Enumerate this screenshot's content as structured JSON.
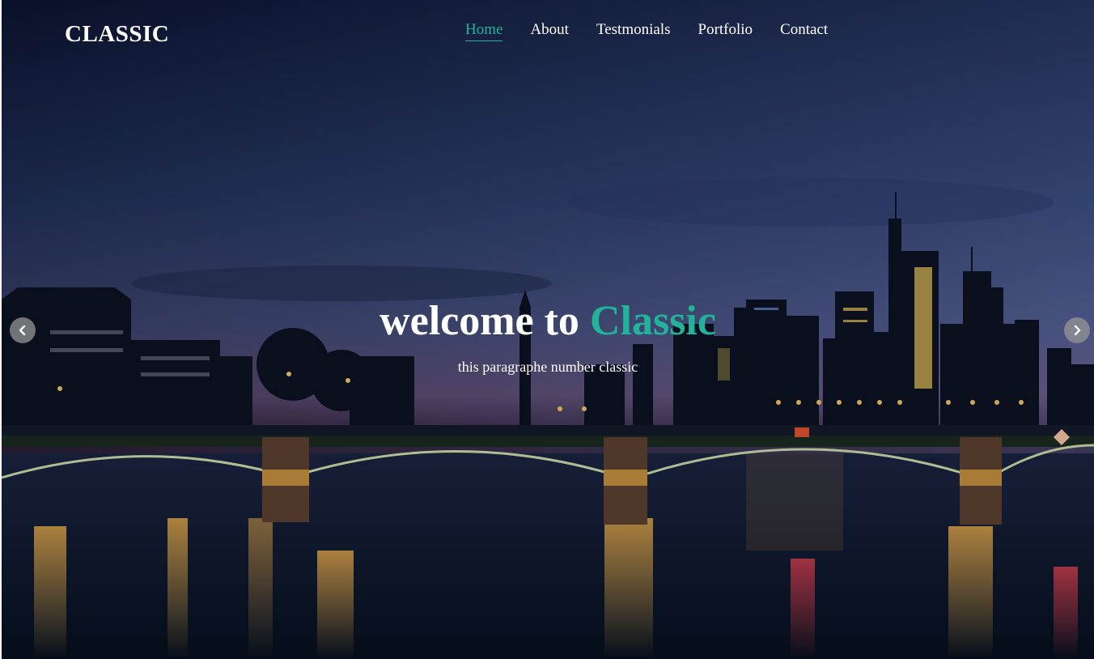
{
  "brand": {
    "name": "CLASSIC"
  },
  "nav": {
    "items": [
      {
        "label": "Home",
        "active": true
      },
      {
        "label": "About",
        "active": false
      },
      {
        "label": "Testmonials",
        "active": false
      },
      {
        "label": "Portfolio",
        "active": false
      },
      {
        "label": "Contact",
        "active": false
      }
    ]
  },
  "hero": {
    "title_prefix": "welcome to ",
    "title_accent": "Classic",
    "subtitle": "this paragraphe number classic",
    "prev_icon": "chevron-left-icon",
    "next_icon": "chevron-right-icon"
  },
  "colors": {
    "accent": "#22b39a",
    "text": "#ffffff",
    "sky_top": "#0d1a3e",
    "sky_horizon": "#5a4a78",
    "water": "#0a1428"
  }
}
